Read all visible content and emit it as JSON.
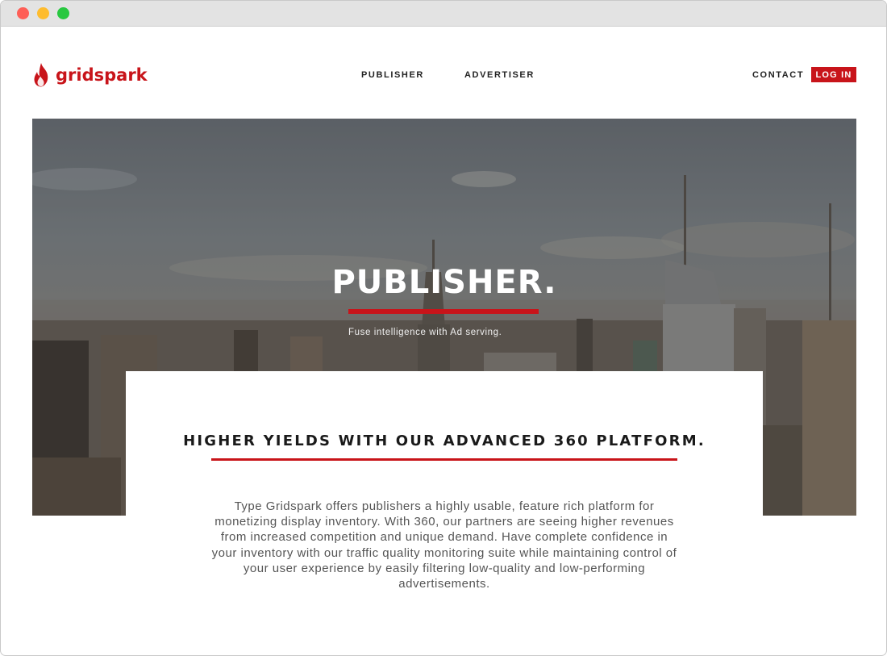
{
  "brand": {
    "name": "gridspark",
    "color": "#c8141a"
  },
  "nav": {
    "publisher": "PUBLISHER",
    "advertiser": "ADVERTISER",
    "contact": "CONTACT",
    "login": "LOG IN"
  },
  "hero": {
    "title": "PUBLISHER.",
    "subtitle": "Fuse intelligence with Ad serving."
  },
  "section": {
    "heading": "HIGHER YIELDS WITH OUR ADVANCED 360 PLATFORM.",
    "body": "Type Gridspark offers publishers a highly usable, feature rich platform for monetizing display inventory. With 360, our partners are seeing higher revenues from increased competition and unique demand. Have complete confidence in your inventory with our traffic quality monitoring suite while maintaining control of your user experience by easily filtering low-quality and low-performing advertisements."
  },
  "icons": {
    "logo": "flame-icon",
    "window_close": "close-dot",
    "window_minimize": "minimize-dot",
    "window_maximize": "maximize-dot"
  }
}
